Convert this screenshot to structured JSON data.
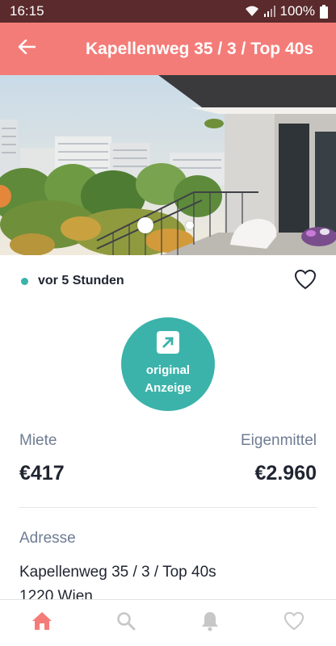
{
  "status_bar": {
    "time": "16:15",
    "battery": "100%"
  },
  "app_bar": {
    "title": "Kapellenweg 35 / 3 / Top 40s",
    "back_icon": "arrow-left-icon"
  },
  "gallery": {
    "image": "apartment-building-balcony-photo",
    "slide_count": 2,
    "active_slide": 1
  },
  "listing": {
    "age": "vor 5 Stunden",
    "original_button_line1": "original",
    "original_button_line2": "Anzeige",
    "rent_label": "Miete",
    "rent_value": "€417",
    "equity_label": "Eigenmittel",
    "equity_value": "€2.960",
    "address_label": "Adresse",
    "address_line1": "Kapellenweg 35 / 3 / Top 40s",
    "address_line2": "1220 Wien"
  },
  "bottom_nav": [
    {
      "name": "home",
      "icon": "home-icon",
      "active": true
    },
    {
      "name": "search",
      "icon": "search-icon",
      "active": false
    },
    {
      "name": "alerts",
      "icon": "bell-icon",
      "active": false
    },
    {
      "name": "favorites",
      "icon": "heart-icon",
      "active": false
    }
  ],
  "colors": {
    "accent": "#f47c78",
    "teal": "#3bb3aa",
    "status_bar": "#5a2a2c",
    "muted": "#6f7c93",
    "nav_inactive": "#c7c7c7"
  }
}
